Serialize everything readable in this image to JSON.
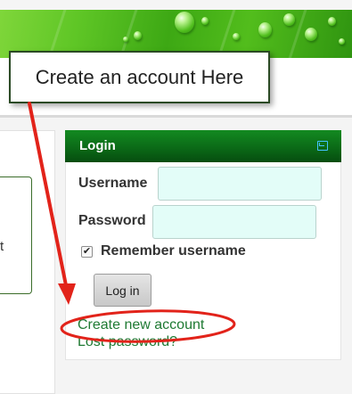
{
  "callout": {
    "text": "Create an account Here"
  },
  "left_panel": {
    "fragment": "t"
  },
  "login_block": {
    "title": "Login",
    "dock_icon": "dock-icon",
    "username_label": "Username",
    "username_value": "",
    "password_label": "Password",
    "password_value": "",
    "remember_checked": "✔",
    "remember_label": "Remember username",
    "login_button": "Log in",
    "create_account_link": "Create new account",
    "lost_password_link": "Lost password?"
  },
  "colors": {
    "header_green": "#0b6a17",
    "link_green": "#1f7a33",
    "field_fill": "#e3fdf8",
    "annotation_red": "#e2231a",
    "dock_icon_blue": "#43c2ff"
  }
}
